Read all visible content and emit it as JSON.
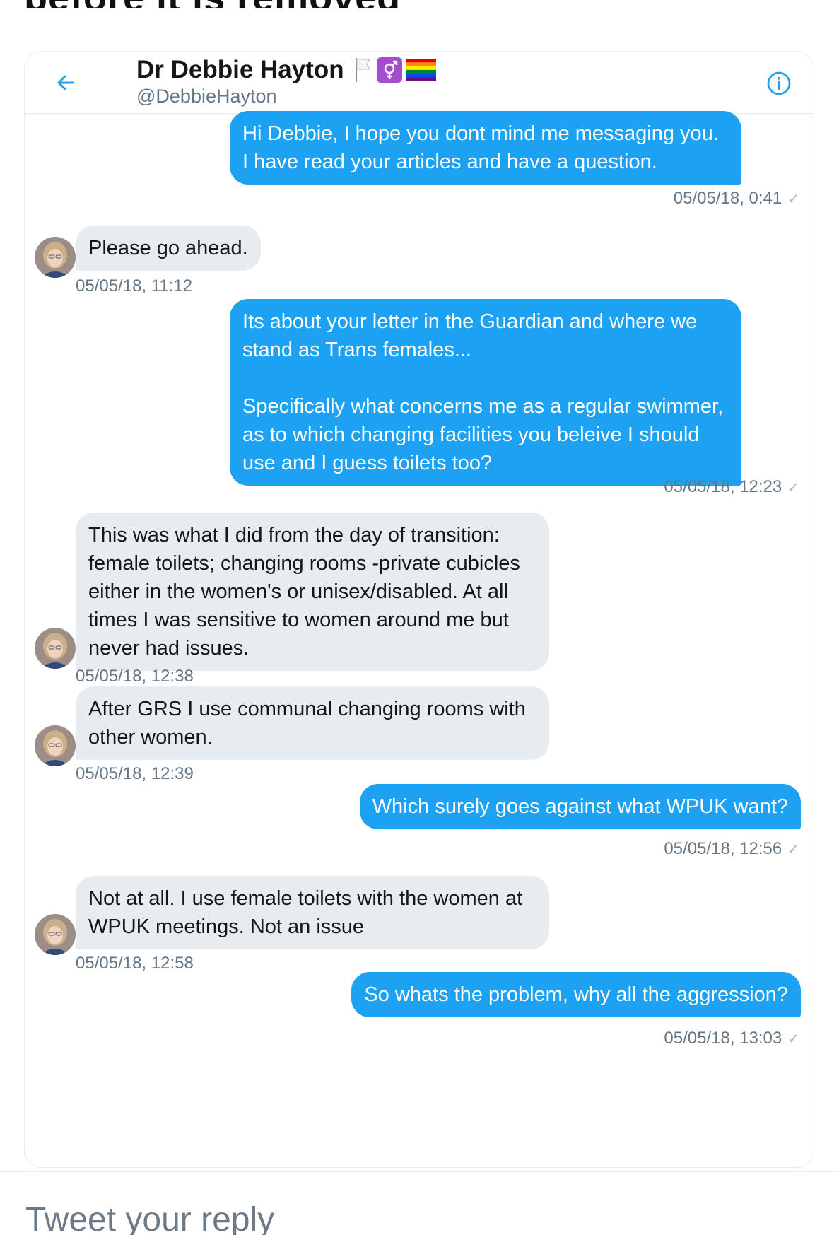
{
  "page": {
    "top_cut_text": "before it is removed"
  },
  "header": {
    "display_name": "Dr Debbie Hayton",
    "handle": "@DebbieHayton",
    "emojis": [
      "white-flag-icon",
      "transgender-symbol-icon",
      "rainbow-flag-icon"
    ]
  },
  "messages": [
    {
      "direction": "out",
      "paragraphs": [
        "Hi Debbie, I hope you dont mind me messaging you. I have read your articles and have a question."
      ],
      "timestamp": "05/05/18, 0:41",
      "read": true
    },
    {
      "direction": "in",
      "paragraphs": [
        "Please go ahead."
      ],
      "timestamp": "05/05/18, 11:12"
    },
    {
      "direction": "out",
      "paragraphs": [
        "Its about your letter in the Guardian and where we stand as Trans females...",
        "Specifically what concerns me as a regular swimmer, as to which changing facilities you beleive I should use and I guess toilets too?"
      ],
      "timestamp": "05/05/18, 12:23",
      "read": true
    },
    {
      "direction": "in",
      "paragraphs": [
        "This was what I did from the day of transition: female toilets; changing rooms -private cubicles either in the women's or unisex/disabled. At all times I was sensitive to women around me but never had issues."
      ],
      "timestamp": "05/05/18, 12:38"
    },
    {
      "direction": "in",
      "paragraphs": [
        "After GRS I use communal changing rooms with other women."
      ],
      "timestamp": "05/05/18, 12:39"
    },
    {
      "direction": "out",
      "paragraphs": [
        "Which surely goes against what WPUK want?"
      ],
      "timestamp": "05/05/18, 12:56",
      "read": true
    },
    {
      "direction": "in",
      "paragraphs": [
        "Not at all. I use female toilets  with the women at WPUK meetings. Not an issue"
      ],
      "timestamp": "05/05/18, 12:58"
    },
    {
      "direction": "out",
      "paragraphs": [
        "So whats the problem, why all the aggression?"
      ],
      "timestamp": "05/05/18, 13:03",
      "read": true
    }
  ],
  "composer": {
    "placeholder": "Tweet your reply"
  },
  "icons": {
    "back": "back-arrow-icon",
    "info": "info-icon",
    "read_receipt": "checkmark-icon"
  },
  "colors": {
    "accent": "#1da1f2",
    "incoming_bubble": "#e6ecf0",
    "timestamp": "#657786"
  }
}
